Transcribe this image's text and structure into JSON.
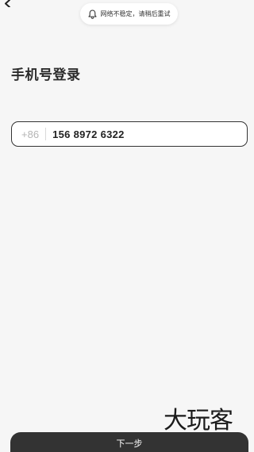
{
  "header": {
    "back_icon": "chevron-left-icon"
  },
  "toast": {
    "icon": "bell-icon",
    "message": "网络不稳定，请稍后重试"
  },
  "login": {
    "title": "手机号登录",
    "country_code": "+86",
    "phone_number": "156 8972 6322"
  },
  "footer": {
    "next_label": "下一步"
  },
  "watermark": {
    "text": "大玩客"
  },
  "colors": {
    "background": "#f6f6f6",
    "button": "#333333",
    "field_border": "#333333",
    "country_code": "#b5b5b5"
  }
}
